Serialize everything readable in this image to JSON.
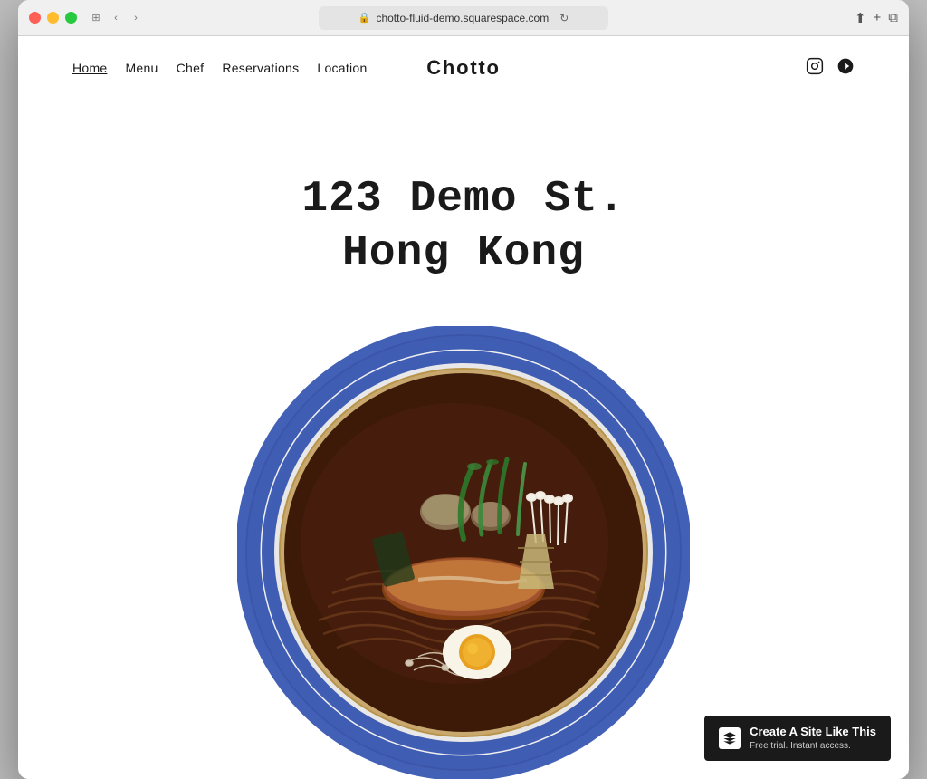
{
  "browser": {
    "url": "chotto-fluid-demo.squarespace.com",
    "lock_icon": "🔒",
    "refresh_icon": "↻"
  },
  "nav": {
    "links": [
      {
        "label": "Home",
        "active": true
      },
      {
        "label": "Menu",
        "active": false
      },
      {
        "label": "Chef",
        "active": false
      },
      {
        "label": "Reservations",
        "active": false
      },
      {
        "label": "Location",
        "active": false
      }
    ],
    "brand": "Chotto",
    "icons": [
      "instagram-icon",
      "yelp-icon"
    ]
  },
  "main": {
    "address_line1": "123 Demo St.",
    "address_line2": "Hong Kong"
  },
  "badge": {
    "title": "Create A Site Like This",
    "subtitle": "Free trial. Instant access."
  }
}
